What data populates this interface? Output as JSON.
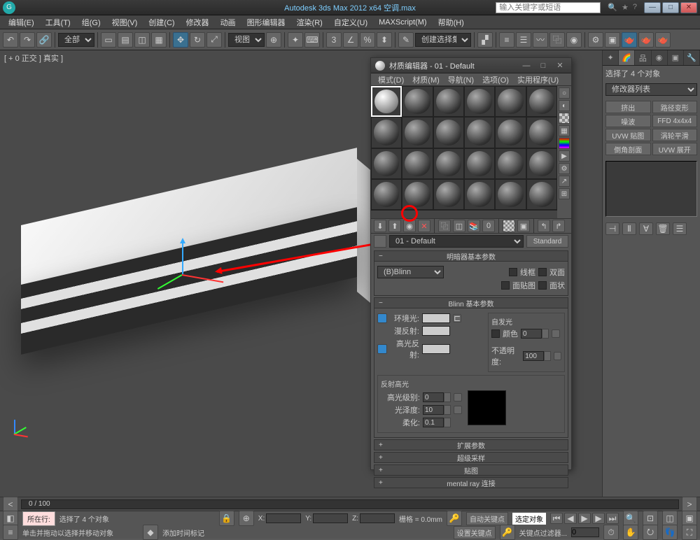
{
  "app": {
    "title": "Autodesk 3ds Max  2012 x64    空调.max",
    "search_placeholder": "输入关键字或短语"
  },
  "menus": [
    "编辑(E)",
    "工具(T)",
    "组(G)",
    "视图(V)",
    "创建(C)",
    "修改器",
    "动画",
    "图形编辑器",
    "渲染(R)",
    "自定义(U)",
    "MAXScript(M)",
    "帮助(H)"
  ],
  "toolbar": {
    "scope": "全部",
    "view_btn": "视图",
    "create_sel": "创建选择集"
  },
  "viewport": {
    "label": "[ + 0 正交 ] 真实 ]"
  },
  "cmd_panel": {
    "selection_info": "选择了 4 个对象",
    "mod_list": "修改器列表",
    "mods": [
      "挤出",
      "路径变形",
      "噪波",
      "FFD 4x4x4",
      "UVW 贴图",
      "涡轮平滑",
      "倒角剖面",
      "UVW 展开"
    ]
  },
  "material_editor": {
    "title": "材质编辑器 - 01 - Default",
    "menus": [
      "模式(D)",
      "材质(M)",
      "导航(N)",
      "选项(O)",
      "实用程序(U)"
    ],
    "mat_name": "01 - Default",
    "mat_type": "Standard",
    "rollouts": {
      "shader_basic": "明暗器基本参数",
      "shader_sel": "(B)Blinn",
      "wire": "线框",
      "two_sided": "双面",
      "face_map": "面贴图",
      "faceted": "面状",
      "blinn_basic": "Blinn 基本参数",
      "self_illum": "自发光",
      "color": "颜色",
      "color_val": "0",
      "ambient": "环境光:",
      "diffuse": "漫反射:",
      "specular": "高光反射:",
      "opacity": "不透明度:",
      "opacity_val": "100",
      "spec_highlights": "反射高光",
      "spec_level": "高光级别:",
      "spec_level_val": "0",
      "glossiness": "光泽度:",
      "glossiness_val": "10",
      "soften": "柔化:",
      "soften_val": "0.1",
      "extended": "扩展参数",
      "supersample": "超级采样",
      "maps": "贴图",
      "mental_ray": "mental ray 连接"
    }
  },
  "status": {
    "timeline": "0 / 100",
    "now": "所在行:",
    "sel_count": "选择了 4 个对象",
    "hint": "单击并拖动以选择并移动对象",
    "add_marker": "添加时间标记",
    "x": "X:",
    "y": "Y:",
    "z": "Z:",
    "grid": "栅格 = 0.0mm",
    "autokey": "自动关键点",
    "setkey": "设置关键点",
    "sel_obj": "选定对象",
    "key_filter": "关键点过滤器..."
  }
}
